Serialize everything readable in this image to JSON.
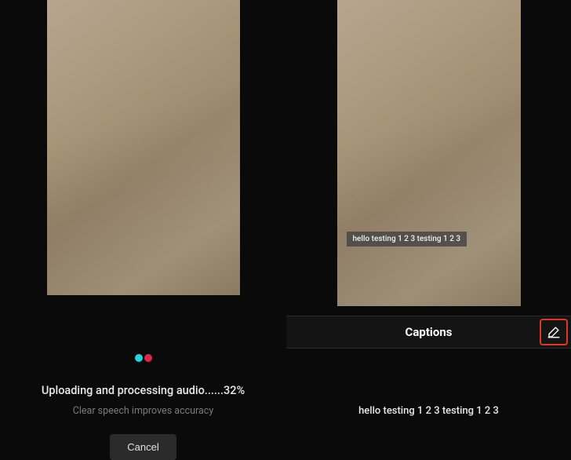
{
  "left": {
    "processing_text": "Uploading and processing audio......32%",
    "hint_text": "Clear speech improves accuracy",
    "cancel_label": "Cancel"
  },
  "right": {
    "overlay_caption": "hello testing 1 2 3 testing 1 2 3",
    "header_title": "Captions",
    "caption_line": "hello testing 1 2 3 testing 1 2 3"
  },
  "colors": {
    "highlight_border": "#e03820",
    "dot_cyan": "#25d2e3",
    "dot_red": "#e3254a"
  }
}
